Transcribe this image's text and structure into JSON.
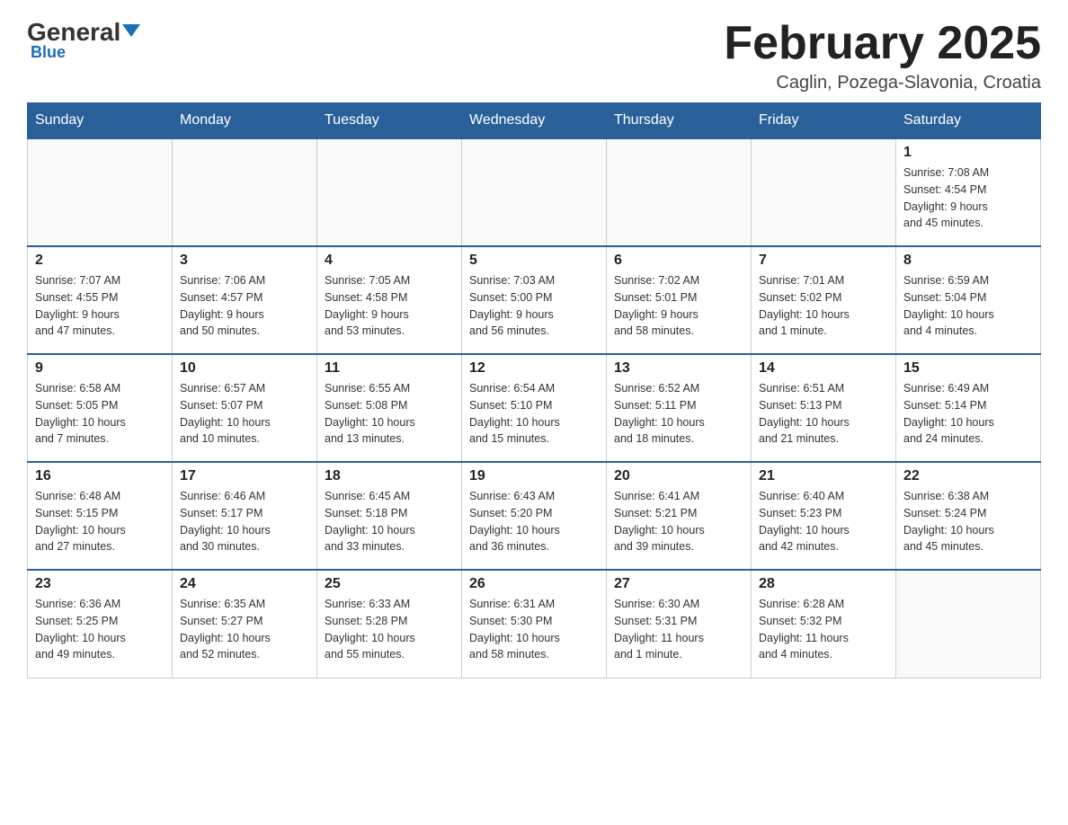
{
  "header": {
    "logo_general": "General",
    "logo_blue": "Blue",
    "month_title": "February 2025",
    "location": "Caglin, Pozega-Slavonia, Croatia"
  },
  "weekdays": [
    "Sunday",
    "Monday",
    "Tuesday",
    "Wednesday",
    "Thursday",
    "Friday",
    "Saturday"
  ],
  "weeks": [
    [
      {
        "day": "",
        "info": ""
      },
      {
        "day": "",
        "info": ""
      },
      {
        "day": "",
        "info": ""
      },
      {
        "day": "",
        "info": ""
      },
      {
        "day": "",
        "info": ""
      },
      {
        "day": "",
        "info": ""
      },
      {
        "day": "1",
        "info": "Sunrise: 7:08 AM\nSunset: 4:54 PM\nDaylight: 9 hours\nand 45 minutes."
      }
    ],
    [
      {
        "day": "2",
        "info": "Sunrise: 7:07 AM\nSunset: 4:55 PM\nDaylight: 9 hours\nand 47 minutes."
      },
      {
        "day": "3",
        "info": "Sunrise: 7:06 AM\nSunset: 4:57 PM\nDaylight: 9 hours\nand 50 minutes."
      },
      {
        "day": "4",
        "info": "Sunrise: 7:05 AM\nSunset: 4:58 PM\nDaylight: 9 hours\nand 53 minutes."
      },
      {
        "day": "5",
        "info": "Sunrise: 7:03 AM\nSunset: 5:00 PM\nDaylight: 9 hours\nand 56 minutes."
      },
      {
        "day": "6",
        "info": "Sunrise: 7:02 AM\nSunset: 5:01 PM\nDaylight: 9 hours\nand 58 minutes."
      },
      {
        "day": "7",
        "info": "Sunrise: 7:01 AM\nSunset: 5:02 PM\nDaylight: 10 hours\nand 1 minute."
      },
      {
        "day": "8",
        "info": "Sunrise: 6:59 AM\nSunset: 5:04 PM\nDaylight: 10 hours\nand 4 minutes."
      }
    ],
    [
      {
        "day": "9",
        "info": "Sunrise: 6:58 AM\nSunset: 5:05 PM\nDaylight: 10 hours\nand 7 minutes."
      },
      {
        "day": "10",
        "info": "Sunrise: 6:57 AM\nSunset: 5:07 PM\nDaylight: 10 hours\nand 10 minutes."
      },
      {
        "day": "11",
        "info": "Sunrise: 6:55 AM\nSunset: 5:08 PM\nDaylight: 10 hours\nand 13 minutes."
      },
      {
        "day": "12",
        "info": "Sunrise: 6:54 AM\nSunset: 5:10 PM\nDaylight: 10 hours\nand 15 minutes."
      },
      {
        "day": "13",
        "info": "Sunrise: 6:52 AM\nSunset: 5:11 PM\nDaylight: 10 hours\nand 18 minutes."
      },
      {
        "day": "14",
        "info": "Sunrise: 6:51 AM\nSunset: 5:13 PM\nDaylight: 10 hours\nand 21 minutes."
      },
      {
        "day": "15",
        "info": "Sunrise: 6:49 AM\nSunset: 5:14 PM\nDaylight: 10 hours\nand 24 minutes."
      }
    ],
    [
      {
        "day": "16",
        "info": "Sunrise: 6:48 AM\nSunset: 5:15 PM\nDaylight: 10 hours\nand 27 minutes."
      },
      {
        "day": "17",
        "info": "Sunrise: 6:46 AM\nSunset: 5:17 PM\nDaylight: 10 hours\nand 30 minutes."
      },
      {
        "day": "18",
        "info": "Sunrise: 6:45 AM\nSunset: 5:18 PM\nDaylight: 10 hours\nand 33 minutes."
      },
      {
        "day": "19",
        "info": "Sunrise: 6:43 AM\nSunset: 5:20 PM\nDaylight: 10 hours\nand 36 minutes."
      },
      {
        "day": "20",
        "info": "Sunrise: 6:41 AM\nSunset: 5:21 PM\nDaylight: 10 hours\nand 39 minutes."
      },
      {
        "day": "21",
        "info": "Sunrise: 6:40 AM\nSunset: 5:23 PM\nDaylight: 10 hours\nand 42 minutes."
      },
      {
        "day": "22",
        "info": "Sunrise: 6:38 AM\nSunset: 5:24 PM\nDaylight: 10 hours\nand 45 minutes."
      }
    ],
    [
      {
        "day": "23",
        "info": "Sunrise: 6:36 AM\nSunset: 5:25 PM\nDaylight: 10 hours\nand 49 minutes."
      },
      {
        "day": "24",
        "info": "Sunrise: 6:35 AM\nSunset: 5:27 PM\nDaylight: 10 hours\nand 52 minutes."
      },
      {
        "day": "25",
        "info": "Sunrise: 6:33 AM\nSunset: 5:28 PM\nDaylight: 10 hours\nand 55 minutes."
      },
      {
        "day": "26",
        "info": "Sunrise: 6:31 AM\nSunset: 5:30 PM\nDaylight: 10 hours\nand 58 minutes."
      },
      {
        "day": "27",
        "info": "Sunrise: 6:30 AM\nSunset: 5:31 PM\nDaylight: 11 hours\nand 1 minute."
      },
      {
        "day": "28",
        "info": "Sunrise: 6:28 AM\nSunset: 5:32 PM\nDaylight: 11 hours\nand 4 minutes."
      },
      {
        "day": "",
        "info": ""
      }
    ]
  ]
}
